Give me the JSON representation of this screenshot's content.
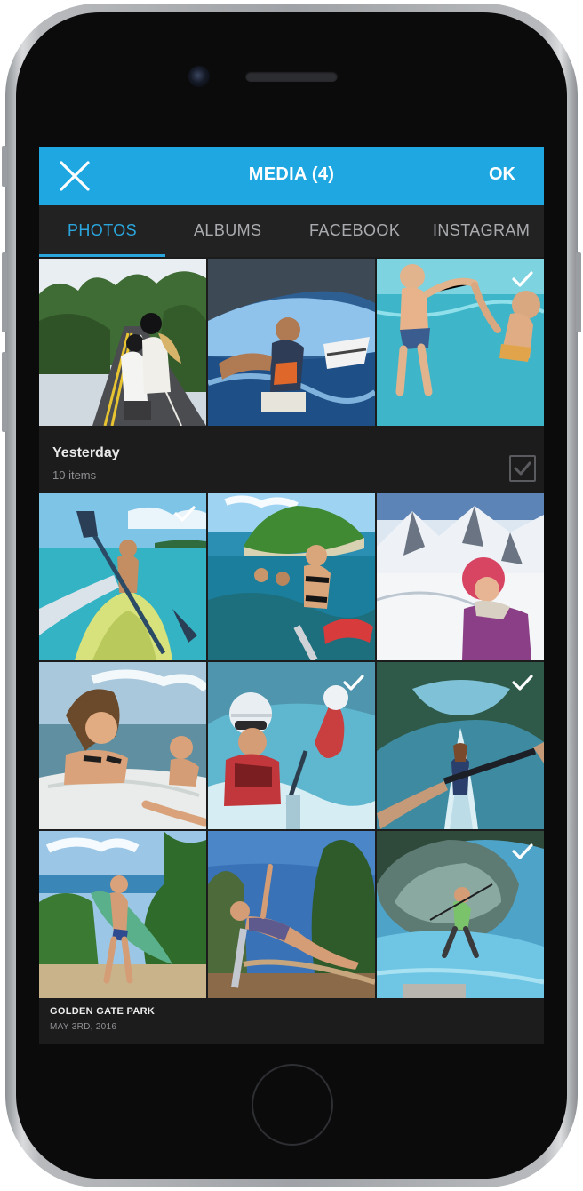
{
  "header": {
    "title": "MEDIA (4)",
    "ok_label": "OK",
    "close_icon": "close-icon",
    "background_color": "#1ea7e1"
  },
  "tabs": [
    {
      "label": "PHOTOS",
      "active": true
    },
    {
      "label": "ALBUMS",
      "active": false
    },
    {
      "label": "FACEBOOK",
      "active": false
    },
    {
      "label": "INSTAGRAM",
      "active": false
    }
  ],
  "group": {
    "title": "Yesterday",
    "subtitle": "10 items",
    "selected": false
  },
  "photos_top": [
    {
      "subject": "scooter-ride",
      "selected": false
    },
    {
      "subject": "wakeboard-selfie",
      "selected": false
    },
    {
      "subject": "kids-underwater",
      "selected": true
    }
  ],
  "photos_grid": [
    {
      "subject": "kayak-tropical",
      "selected": true
    },
    {
      "subject": "island-swimmers",
      "selected": false
    },
    {
      "subject": "snow-mountain-selfie",
      "selected": false
    },
    {
      "subject": "surfboard-girls",
      "selected": false
    },
    {
      "subject": "rafting-helmet",
      "selected": true
    },
    {
      "subject": "paddleboard-river",
      "selected": true
    },
    {
      "subject": "beach-surfer",
      "selected": false
    },
    {
      "subject": "yoga-pose",
      "selected": false
    },
    {
      "subject": "cliff-swing",
      "selected": true
    }
  ],
  "album_footer": {
    "title": "GOLDEN GATE PARK",
    "date": "MAY 3RD, 2016"
  },
  "colors": {
    "accent": "#1ea7e1",
    "screen_bg": "#1c1c1d",
    "tab_active": "#2aa6dd"
  }
}
